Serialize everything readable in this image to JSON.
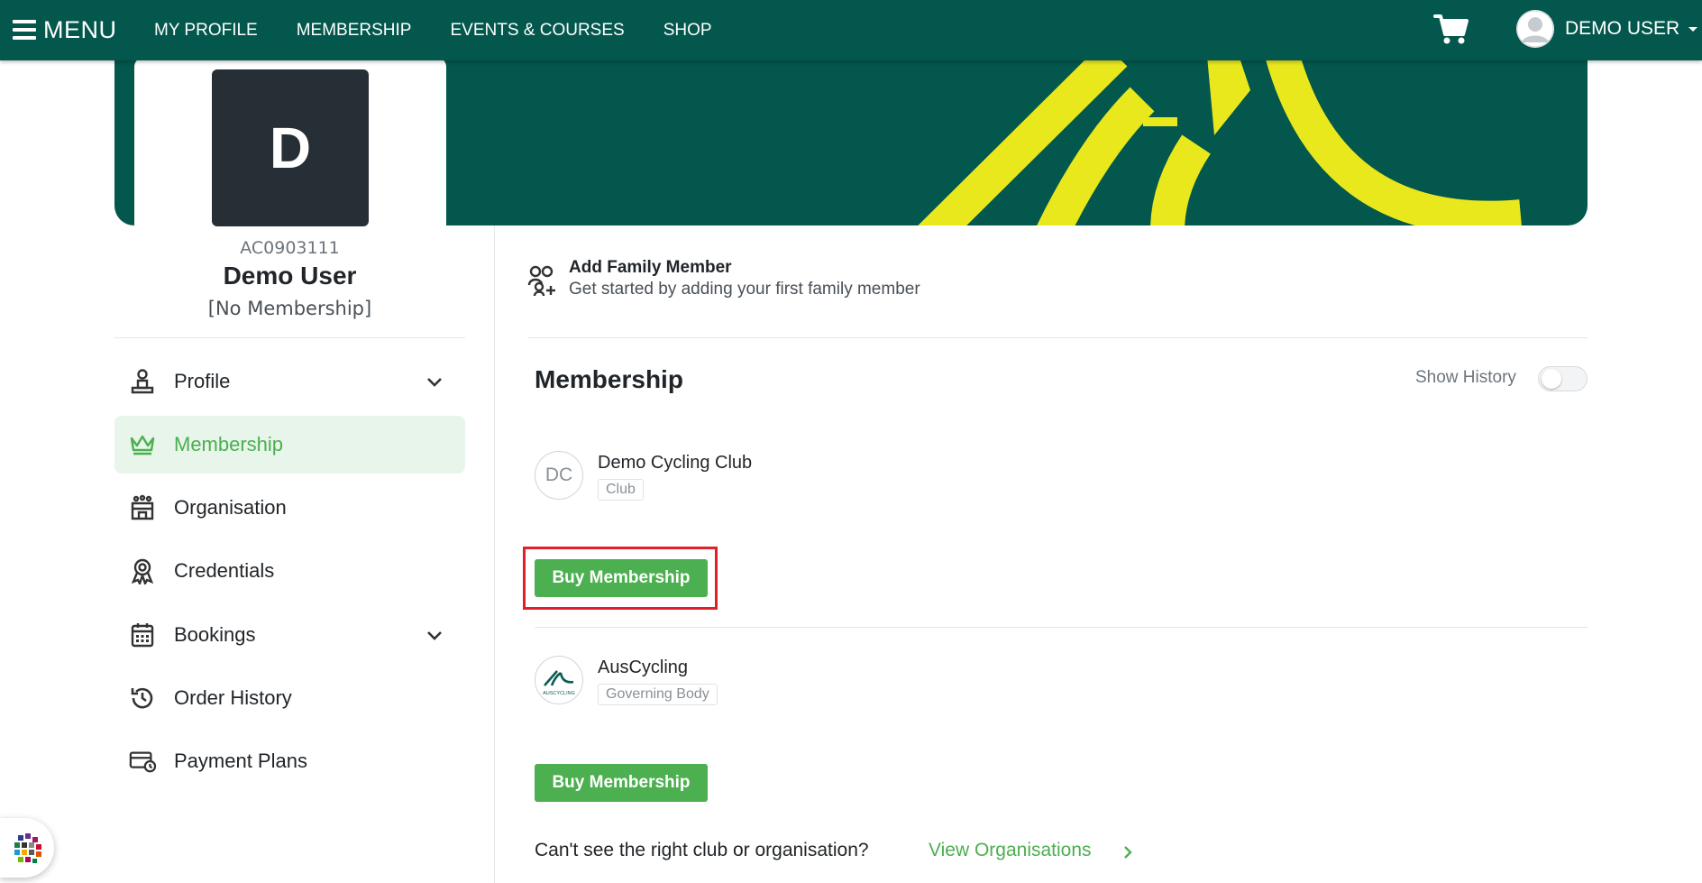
{
  "topnav": {
    "menu_label": "MENU",
    "links": [
      "MY PROFILE",
      "MEMBERSHIP",
      "EVENTS & COURSES",
      "SHOP"
    ],
    "user_name": "DEMO USER",
    "cart_icon": "cart-icon",
    "avatar_icon": "user-avatar-icon"
  },
  "profile": {
    "avatar_letter": "D",
    "member_id": "AC0903111",
    "name": "Demo User",
    "status": "[No Membership]"
  },
  "sidebar": {
    "items": [
      {
        "label": "Profile",
        "icon": "profile-icon",
        "expandable": true,
        "active": false
      },
      {
        "label": "Membership",
        "icon": "crown-icon",
        "expandable": false,
        "active": true
      },
      {
        "label": "Organisation",
        "icon": "organisation-icon",
        "expandable": false,
        "active": false
      },
      {
        "label": "Credentials",
        "icon": "award-icon",
        "expandable": false,
        "active": false
      },
      {
        "label": "Bookings",
        "icon": "calendar-icon",
        "expandable": true,
        "active": false
      },
      {
        "label": "Order History",
        "icon": "history-icon",
        "expandable": false,
        "active": false
      },
      {
        "label": "Payment Plans",
        "icon": "payment-plan-icon",
        "expandable": false,
        "active": false
      }
    ]
  },
  "family": {
    "title": "Add Family Member",
    "subtitle": "Get started by adding your first family member"
  },
  "membership": {
    "title": "Membership",
    "show_history_label": "Show History",
    "show_history_on": false,
    "orgs": [
      {
        "initials": "DC",
        "name": "Demo Cycling Club",
        "type": "Club",
        "button": "Buy Membership"
      },
      {
        "initials": "",
        "name": "AusCycling",
        "type": "Governing Body",
        "button": "Buy Membership",
        "logo_text": "AUSCYCLING"
      }
    ]
  },
  "footer": {
    "question": "Can't see the right club or organisation?",
    "link": "View Organisations"
  },
  "colors": {
    "brand_dark": "#03574d",
    "accent_green": "#4caf50",
    "banner_yellow": "#e9e81d",
    "highlight_red": "#e01f2a"
  }
}
